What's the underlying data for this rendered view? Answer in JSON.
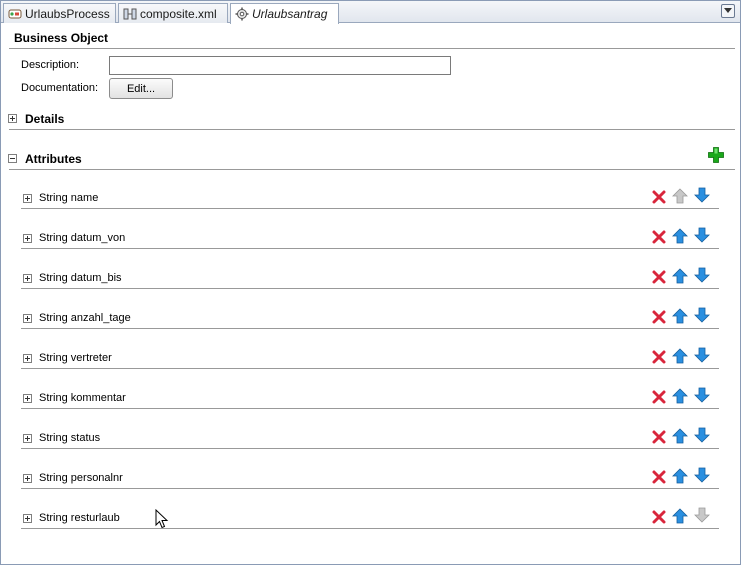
{
  "tabs": [
    {
      "label": "UrlaubsProcess",
      "icon": "bpmn-process-icon",
      "active": false
    },
    {
      "label": "composite.xml",
      "icon": "composite-icon",
      "active": false
    },
    {
      "label": "Urlaubsantrag",
      "icon": "business-object-icon",
      "active": true
    }
  ],
  "business_object": {
    "title": "Business Object",
    "description_label": "Description:",
    "description_value": "",
    "documentation_label": "Documentation:",
    "edit_button": "Edit..."
  },
  "details": {
    "title": "Details",
    "expanded": false
  },
  "attributes": {
    "title": "Attributes",
    "expanded": true,
    "add_icon": "add-icon",
    "items": [
      {
        "label": "String name",
        "up_enabled": false,
        "down_enabled": true
      },
      {
        "label": "String datum_von",
        "up_enabled": true,
        "down_enabled": true
      },
      {
        "label": "String datum_bis",
        "up_enabled": true,
        "down_enabled": true
      },
      {
        "label": "String anzahl_tage",
        "up_enabled": true,
        "down_enabled": true
      },
      {
        "label": "String vertreter",
        "up_enabled": true,
        "down_enabled": true
      },
      {
        "label": "String kommentar",
        "up_enabled": true,
        "down_enabled": true
      },
      {
        "label": "String status",
        "up_enabled": true,
        "down_enabled": true
      },
      {
        "label": "String personalnr",
        "up_enabled": true,
        "down_enabled": true
      },
      {
        "label": "String resturlaub",
        "up_enabled": true,
        "down_enabled": false
      }
    ]
  },
  "colors": {
    "delete": "#d9263c",
    "arrow": "#2a8fe0",
    "arrow_disabled": "#c8c8c8",
    "add": "#1aa81a"
  }
}
